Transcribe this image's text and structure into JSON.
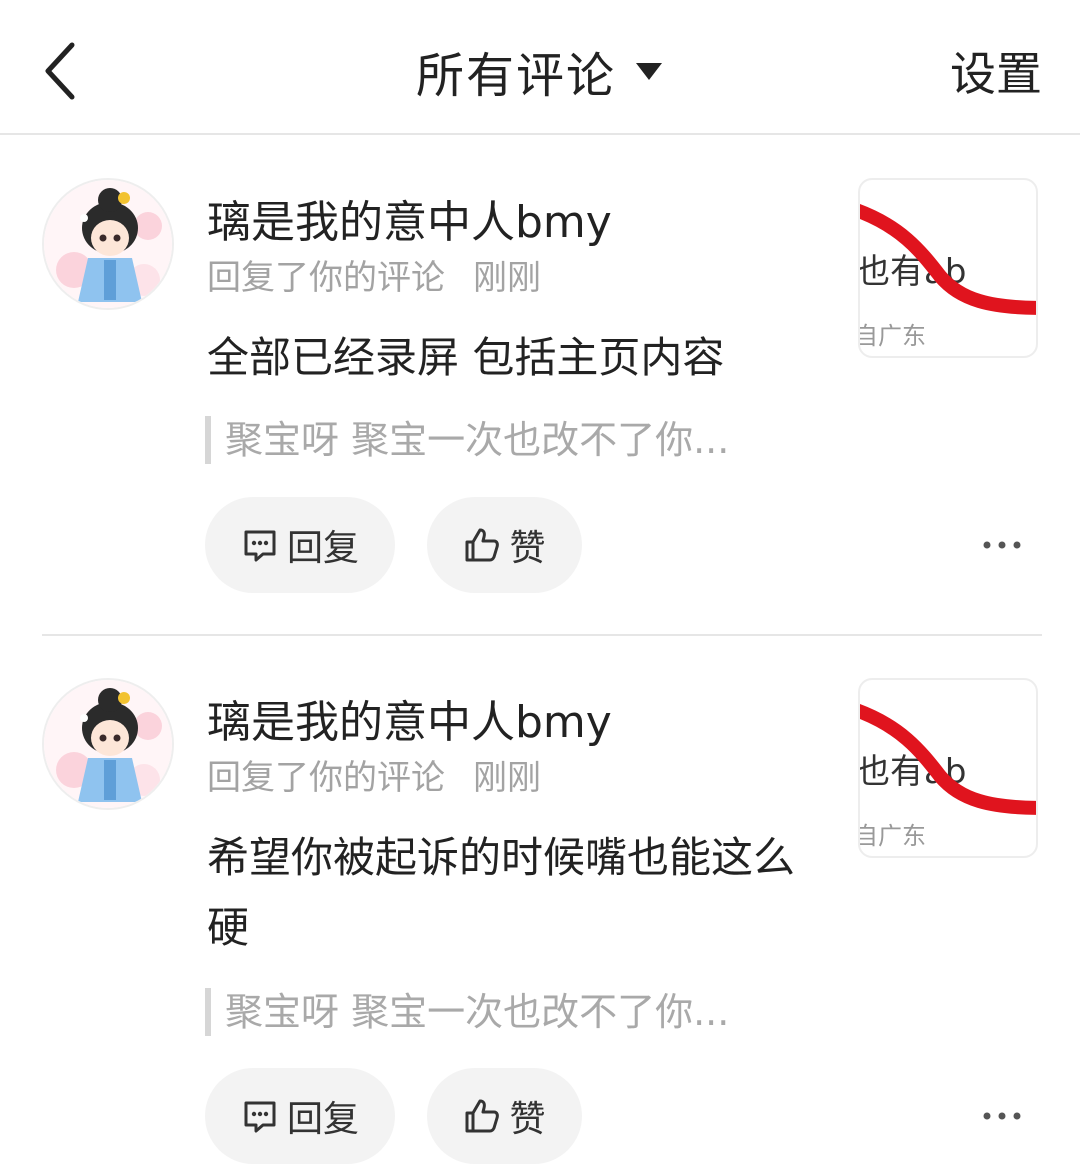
{
  "header": {
    "title": "所有评论",
    "settings_label": "设置"
  },
  "comments": [
    {
      "username": "璃是我的意中人bmy",
      "action_text": "回复了你的评论",
      "time": "刚刚",
      "content": "全部已经录屏 包括主页内容",
      "quote": "聚宝呀 聚宝一次也改不了你...",
      "reply_label": "回复",
      "like_label": "赞",
      "thumb_text": "也有ab",
      "thumb_location": "自广东"
    },
    {
      "username": "璃是我的意中人bmy",
      "action_text": "回复了你的评论",
      "time": "刚刚",
      "content": "希望你被起诉的时候嘴也能这么硬",
      "quote": "聚宝呀 聚宝一次也改不了你...",
      "reply_label": "回复",
      "like_label": "赞",
      "thumb_text": "也有ab",
      "thumb_location": "自广东"
    }
  ],
  "colors": {
    "accent_red": "#e0141e",
    "text_primary": "#222222",
    "text_secondary": "#a3a3a3",
    "button_bg": "#f3f3f3"
  },
  "icons": {
    "back": "chevron-left-icon",
    "dropdown": "caret-down-icon",
    "reply": "comment-bubble-icon",
    "like": "thumbs-up-icon",
    "more": "more-dots-icon"
  }
}
